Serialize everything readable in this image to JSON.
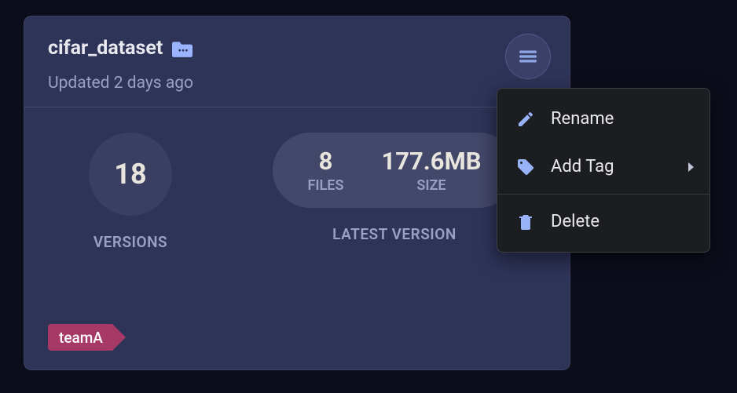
{
  "card": {
    "title": "cifar_dataset",
    "updated_text": "Updated 2 days ago",
    "versions": {
      "count": "18",
      "label": "VERSIONS"
    },
    "latest": {
      "label": "LATEST VERSION",
      "files_value": "8",
      "files_label": "FILES",
      "size_value": "177.6MB",
      "size_label": "SIZE"
    },
    "tag": "teamA"
  },
  "menu": {
    "rename": "Rename",
    "add_tag": "Add Tag",
    "delete": "Delete"
  },
  "icons": {
    "folder": "folder-icon",
    "hamburger": "hamburger-icon",
    "pencil": "pencil-icon",
    "tag": "tag-icon",
    "trash": "trash-icon"
  },
  "colors": {
    "background": "#0b0e1a",
    "card_bg": "#2e3358",
    "menu_bg": "#1c1d21",
    "accent_icon": "#98b2f7",
    "tag_bg": "#a63965",
    "text_primary": "#e8e8ef",
    "text_muted": "#9aa0c3"
  }
}
